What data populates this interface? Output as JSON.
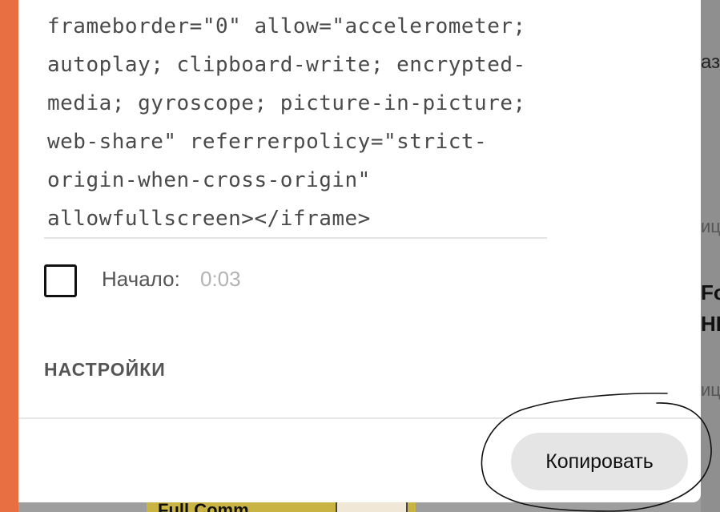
{
  "embed_code": {
    "lines": [
      "frameborder=\"0\" allow=\"accelerometer;",
      "autoplay; clipboard-write; encrypted-",
      "media; gyroscope; picture-in-picture;",
      "web-share\" referrerpolicy=\"strict-",
      "origin-when-cross-origin\"",
      "allowfullscreen></iframe>"
    ]
  },
  "start_option": {
    "checked": false,
    "label": "Начало:",
    "time": "0:03"
  },
  "settings_heading": "НАСТРОЙКИ",
  "copy_button_label": "Копировать",
  "background": {
    "fragments": [
      "аза",
      "ица",
      "Fo",
      "HI",
      "ице"
    ],
    "thumbnail_text": "Full Comm"
  },
  "colors": {
    "accent_strip": "#e86f42",
    "button_bg": "#e5e5e5",
    "annotation_ink": "#111111"
  }
}
